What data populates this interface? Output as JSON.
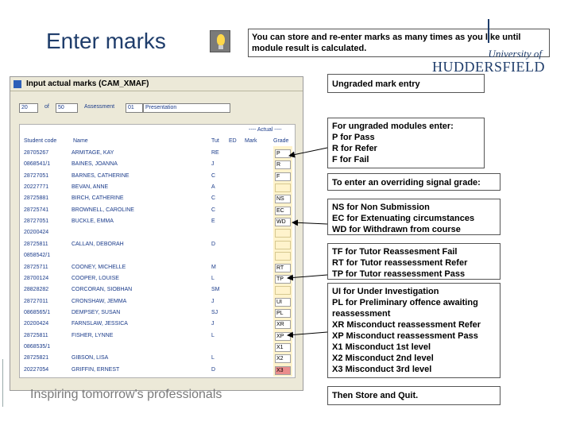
{
  "slide": {
    "title": "Enter marks",
    "note": "You can store and re-enter marks as many times as you like until module result is calculated.",
    "university_of": "University of",
    "university_name": "HUDDERSFIELD",
    "tagline": "Inspiring tomorrow's professionals"
  },
  "window": {
    "title": "Input actual marks (CAM_XMAF)",
    "filters": {
      "f1": "20",
      "of_label": "of",
      "f2": "50",
      "assessment_label": "Assessment",
      "assessment_value": "01",
      "type_value": "Presentation"
    },
    "actual_header": "---- Actual ----",
    "columns": {
      "student_code": "Student code",
      "name": "Name",
      "tutor": "Tut",
      "ed": "ED",
      "mark": "Mark",
      "grade": "Grade"
    },
    "rows": [
      {
        "code": "28705267",
        "name": "ARMITAGE, KAY",
        "tutor": "RE",
        "grade": "P",
        "red": false
      },
      {
        "code": "0868541/1",
        "name": "BAINES, JOANNA",
        "tutor": "J",
        "grade": "R",
        "red": false
      },
      {
        "code": "28727051",
        "name": "BARNES, CATHERINE",
        "tutor": "C",
        "grade": "F",
        "red": false
      },
      {
        "code": "20227771",
        "name": "BEVAN, ANNE",
        "tutor": "A",
        "grade": "",
        "red": false
      },
      {
        "code": "28725881",
        "name": "BIRCH, CATHERINE",
        "tutor": "C",
        "grade": "NS",
        "red": false
      },
      {
        "code": "28725741",
        "name": "BROWNELL, CAROLINE",
        "tutor": "C",
        "grade": "EC",
        "red": false
      },
      {
        "code": "28727051",
        "name": "BUCKLE, EMMA",
        "tutor": "E",
        "grade": "WD",
        "red": false
      },
      {
        "code": "20200424",
        "name": "",
        "tutor": "",
        "grade": "",
        "red": false
      },
      {
        "code": "28725811",
        "name": "CALLAN, DEBORAH",
        "tutor": "D",
        "grade": "",
        "red": false
      },
      {
        "code": "0858542/1",
        "name": "",
        "tutor": "",
        "grade": "",
        "red": false
      },
      {
        "code": "28725711",
        "name": "COONEY, MICHELLE",
        "tutor": "M",
        "grade": "RT",
        "red": false
      },
      {
        "code": "28700124",
        "name": "COOPER, LOUISE",
        "tutor": "L",
        "grade": "TP",
        "red": false
      },
      {
        "code": "28828282",
        "name": "CORCORAN, SIOBHAN",
        "tutor": "SM",
        "grade": "",
        "red": false
      },
      {
        "code": "28727011",
        "name": "CRONSHAW, JEMMA",
        "tutor": "J",
        "grade": "UI",
        "red": false
      },
      {
        "code": "0868565/1",
        "name": "DEMPSEY, SUSAN",
        "tutor": "SJ",
        "grade": "PL",
        "red": false
      },
      {
        "code": "20200424",
        "name": "FARNSLAW, JESSICA",
        "tutor": "J",
        "grade": "XR",
        "red": false
      },
      {
        "code": "28725811",
        "name": "FISHER, LYNNE",
        "tutor": "L",
        "grade": "XP",
        "red": false
      },
      {
        "code": "0868535/1",
        "name": "",
        "tutor": "",
        "grade": "X1",
        "red": false
      },
      {
        "code": "28725821",
        "name": "GIBSON, LISA",
        "tutor": "L",
        "grade": "X2",
        "red": false
      },
      {
        "code": "20227054",
        "name": "GRIFFIN, ERNEST",
        "tutor": "D",
        "grade": "X3",
        "red": true
      }
    ]
  },
  "callouts": {
    "ungraded_entry": "Ungraded mark entry",
    "ungraded_modules": [
      "For ungraded modules enter:",
      "P for Pass",
      "R for Refer",
      "F for Fail"
    ],
    "overriding": "To enter an overriding signal grade:",
    "signal_grades": [
      "NS for Non Submission",
      "EC for Extenuating circumstances",
      "WD for Withdrawn from course"
    ],
    "tutor_reassessment": [
      "TF for Tutor Reassesment Fail",
      "RT for Tutor reassessment Refer",
      "TP for Tutor reassessment Pass"
    ],
    "misconduct": [
      "UI for Under Investigation",
      "PL for Preliminary offence awaiting",
      "reassessment",
      "XR Misconduct reassessment Refer",
      "XP Misconduct reassessment Pass",
      "X1 Misconduct 1st level",
      "X2 Misconduct 2nd level",
      "X3 Misconduct 3rd level"
    ],
    "store_quit": "Then Store and Quit."
  },
  "colors": {
    "title": "#1f3d6b",
    "grade_red": "#ea8c8c",
    "grade_column": "#fff3cc",
    "table_text": "#1a3b8a"
  }
}
